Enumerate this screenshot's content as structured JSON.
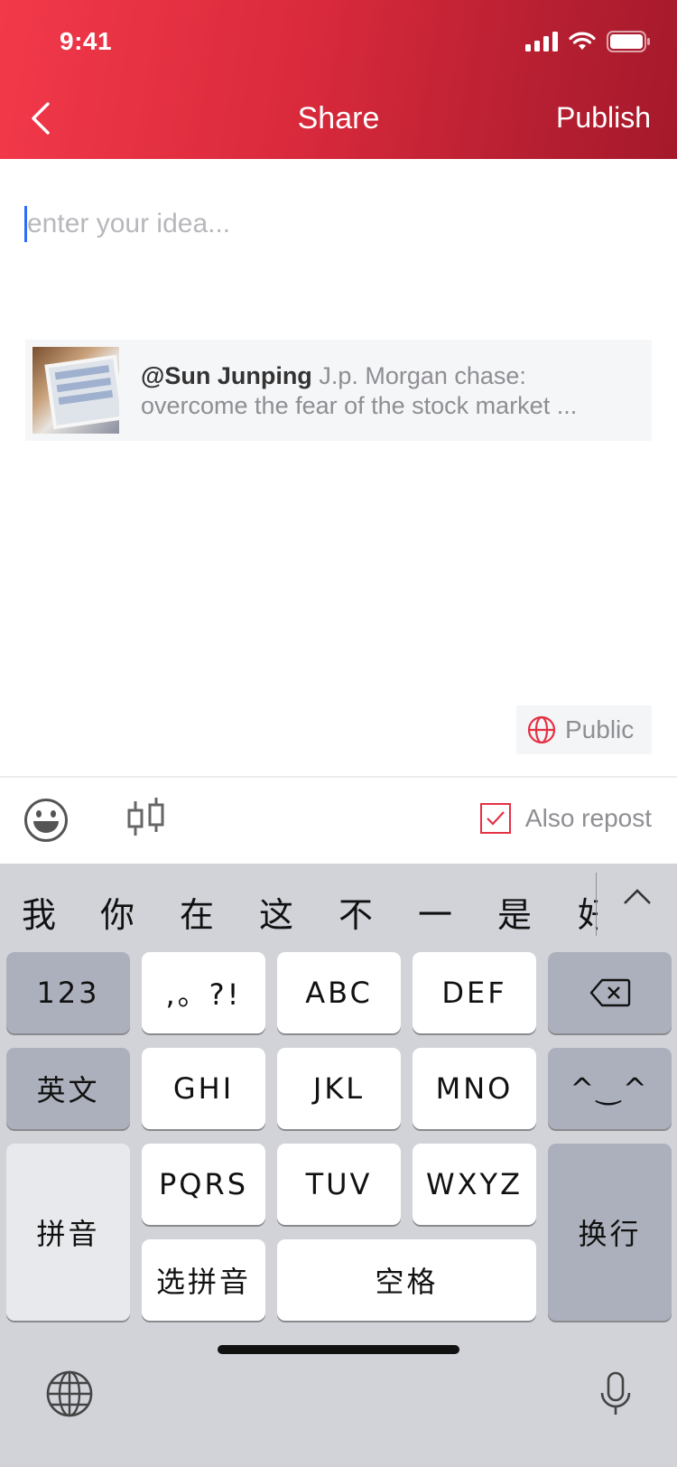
{
  "status_bar": {
    "time": "9:41"
  },
  "header": {
    "title": "Share",
    "publish_label": "Publish"
  },
  "composer": {
    "placeholder": "enter your idea...",
    "value": ""
  },
  "shared_post": {
    "author": "@Sun Junping",
    "text": " J.p. Morgan chase: overcome the fear of the stock market ..."
  },
  "visibility": {
    "label": "Public"
  },
  "toolbar": {
    "also_repost_label": "Also repost",
    "also_repost_checked": true
  },
  "keyboard": {
    "candidates": [
      "我",
      "你",
      "在",
      "这",
      "不",
      "一",
      "是",
      "好"
    ],
    "keys": {
      "num": "123",
      "punct": ",。?!",
      "abc": "ABC",
      "def": "DEF",
      "english": "英文",
      "ghi": "GHI",
      "jkl": "JKL",
      "mno": "MNO",
      "emoticon": "^‿^",
      "pinyin": "拼音",
      "pqrs": "PQRS",
      "tuv": "TUV",
      "wxyz": "WXYZ",
      "return": "换行",
      "select_pinyin": "选拼音",
      "space": "空格"
    }
  },
  "colors": {
    "accent": "#e53144",
    "header_start": "#f2394a",
    "header_end": "#a5192b",
    "caret": "#2f6cf6"
  }
}
